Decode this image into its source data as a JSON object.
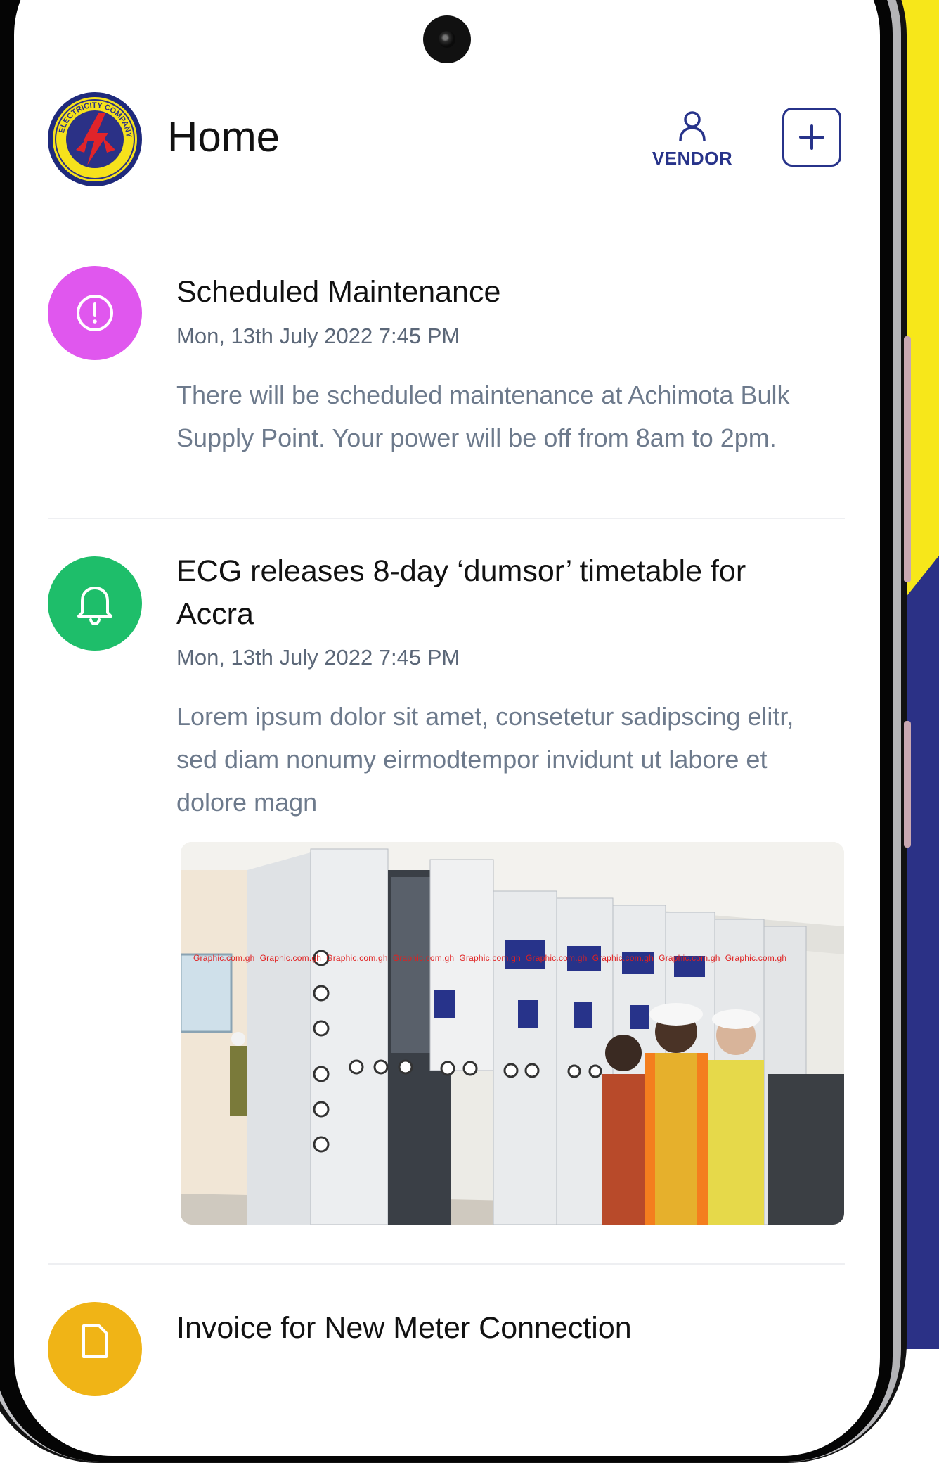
{
  "header": {
    "title": "Home",
    "vendor_label": "VENDOR",
    "logo_alt": "ELECTRICITY COMPANY GHANA LTD."
  },
  "feed": [
    {
      "icon": "alert-circle-icon",
      "icon_color": "#e057ee",
      "title": "Scheduled Maintenance",
      "date": "Mon, 13th July 2022 7:45 PM",
      "body": "There will be scheduled maintenance at Achimota Bulk Supply Point. Your power will be off from 8am to 2pm."
    },
    {
      "icon": "bell-icon",
      "icon_color": "#1ebe6a",
      "title": "ECG releases 8-day ‘dumsor’ timetable for Accra",
      "date": "Mon, 13th July 2022 7:45 PM",
      "body": "Lorem ipsum dolor sit amet, consetetur sadipscing elitr, sed diam nonumy eirmodtempor invidunt ut labore  et dolore magn",
      "image_watermark": "Graphic.com.gh"
    },
    {
      "icon": "document-icon",
      "icon_color": "#f0b416",
      "title": "Invoice for New Meter Connection"
    }
  ],
  "colors": {
    "brand_navy": "#27338a",
    "brand_yellow": "#f7e71a"
  }
}
